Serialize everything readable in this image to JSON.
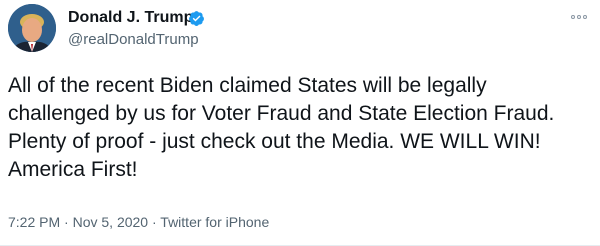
{
  "user": {
    "display_name": "Donald J. Trump",
    "handle": "@realDonaldTrump",
    "verified": true
  },
  "tweet": {
    "text": "All of the recent Biden claimed States will be legally challenged by us for Voter Fraud and State Election Fraud. Plenty of proof - just check out the Media. WE WILL WIN! America First!",
    "time": "7:22 PM",
    "date": "Nov 5, 2020",
    "source": "Twitter for iPhone",
    "separator": "·"
  },
  "icons": {
    "verified": "verified-badge-icon",
    "more": "more-options-icon"
  },
  "colors": {
    "text": "#0f1419",
    "secondary_text": "#536471",
    "verified_blue": "#1d9bf0",
    "divider": "#e6ecf0"
  }
}
